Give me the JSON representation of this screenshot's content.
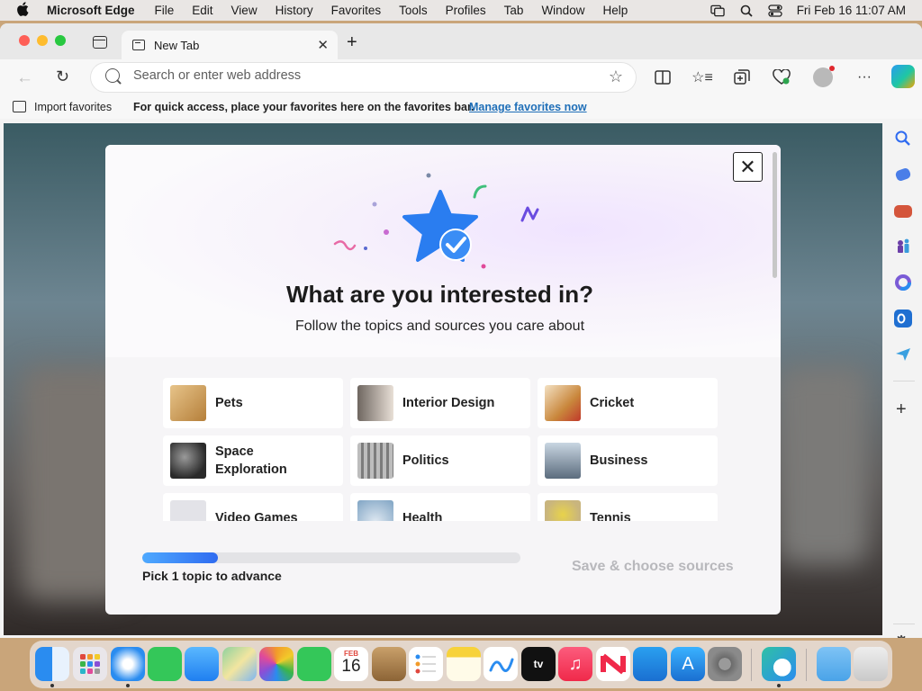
{
  "menubar": {
    "app_name": "Microsoft Edge",
    "menus": [
      "File",
      "Edit",
      "View",
      "History",
      "Favorites",
      "Tools",
      "Profiles",
      "Tab",
      "Window",
      "Help"
    ],
    "datetime": "Fri Feb 16  11:07 AM"
  },
  "browser": {
    "tab_title": "New Tab",
    "address_placeholder": "Search or enter web address",
    "favorites": {
      "import_label": "Import favorites",
      "hint": "For quick access, place your favorites here on the favorites bar.",
      "manage_link": "Manage favorites now"
    }
  },
  "dialog": {
    "title": "What are you interested in?",
    "subtitle": "Follow the topics and sources you care about",
    "close_glyph": "✕",
    "topics": [
      {
        "label": "Pets",
        "thumb_color": "#d9a45c"
      },
      {
        "label": "Interior Design",
        "thumb_color": "#8a7e74"
      },
      {
        "label": "Cricket",
        "thumb_color": "#c9873c"
      },
      {
        "label": "Space Exploration",
        "thumb_color": "#3a3a3a"
      },
      {
        "label": "Politics",
        "thumb_color": "#9a9a9a"
      },
      {
        "label": "Business",
        "thumb_color": "#7d8fa3"
      },
      {
        "label": "Video Games",
        "thumb_color": "#d7d7dc"
      },
      {
        "label": "Health",
        "thumb_color": "#7fa4c4"
      },
      {
        "label": "Tennis",
        "thumb_color": "#c9b57e"
      }
    ],
    "progress_fraction": 0.2,
    "progress_text": "Pick 1 topic to advance",
    "save_label": "Save & choose sources"
  },
  "colors": {
    "accent_blue": "#2f6bf0",
    "link_blue": "#1f6fb8",
    "disabled_text": "#b8b8bc"
  },
  "dock": {
    "calendar_month": "FEB",
    "calendar_day": "16",
    "apps": [
      "finder-icon",
      "launchpad-icon",
      "safari-icon",
      "messages-icon",
      "mail-icon",
      "maps-icon",
      "photos-icon",
      "facetime-icon",
      "calendar-icon",
      "contacts-icon",
      "reminders-icon",
      "notes-icon",
      "freeform-icon",
      "apple-tv-icon",
      "music-icon",
      "news-icon",
      "keynote-icon",
      "app-store-icon",
      "system-settings-icon",
      "edge-icon",
      "downloads-folder-icon",
      "trash-icon"
    ]
  }
}
